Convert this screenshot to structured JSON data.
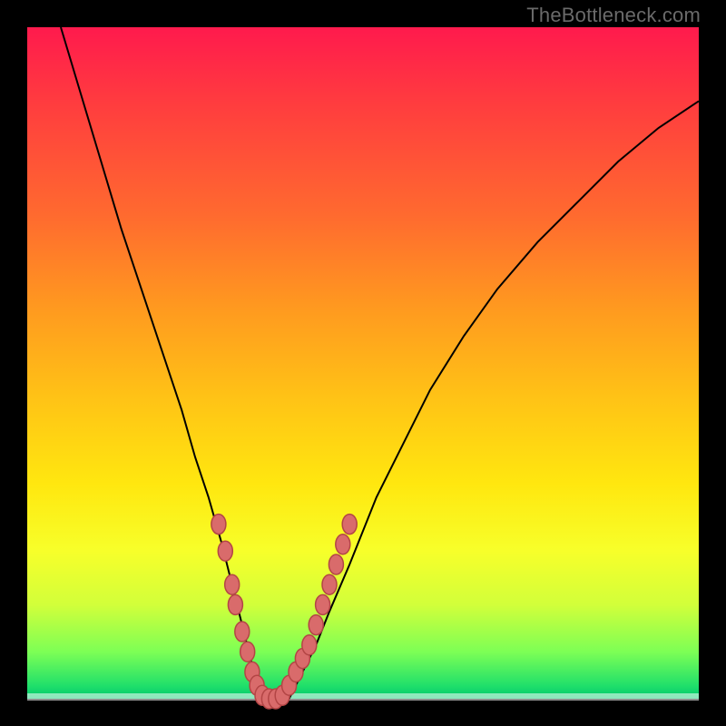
{
  "watermark": "TheBottleneck.com",
  "chart_data": {
    "type": "line",
    "title": "",
    "xlabel": "",
    "ylabel": "",
    "xlim": [
      0,
      100
    ],
    "ylim": [
      0,
      100
    ],
    "grid": false,
    "legend": false,
    "series": [
      {
        "name": "bottleneck-curve",
        "x": [
          5,
          8,
          11,
          14,
          17,
          20,
          23,
          25,
          27,
          29,
          30.5,
          32,
          33,
          34,
          35,
          37,
          39,
          41,
          43,
          45,
          48,
          52,
          56,
          60,
          65,
          70,
          76,
          82,
          88,
          94,
          100
        ],
        "y": [
          100,
          90,
          80,
          70,
          61,
          52,
          43,
          36,
          30,
          23,
          17,
          11,
          7,
          3,
          0,
          0,
          0,
          4,
          8,
          13,
          20,
          30,
          38,
          46,
          54,
          61,
          68,
          74,
          80,
          85,
          89
        ]
      }
    ],
    "markers_cluster": {
      "name": "highlighted-points",
      "points": [
        {
          "x": 28.5,
          "y": 26
        },
        {
          "x": 29.5,
          "y": 22
        },
        {
          "x": 30.5,
          "y": 17
        },
        {
          "x": 31,
          "y": 14
        },
        {
          "x": 32,
          "y": 10
        },
        {
          "x": 32.8,
          "y": 7
        },
        {
          "x": 33.5,
          "y": 4
        },
        {
          "x": 34.2,
          "y": 2
        },
        {
          "x": 35,
          "y": 0.5
        },
        {
          "x": 36,
          "y": 0
        },
        {
          "x": 37,
          "y": 0
        },
        {
          "x": 38,
          "y": 0.5
        },
        {
          "x": 39,
          "y": 2
        },
        {
          "x": 40,
          "y": 4
        },
        {
          "x": 41,
          "y": 6
        },
        {
          "x": 42,
          "y": 8
        },
        {
          "x": 43,
          "y": 11
        },
        {
          "x": 44,
          "y": 14
        },
        {
          "x": 45,
          "y": 17
        },
        {
          "x": 46,
          "y": 20
        },
        {
          "x": 47,
          "y": 23
        },
        {
          "x": 48,
          "y": 26
        }
      ]
    }
  }
}
